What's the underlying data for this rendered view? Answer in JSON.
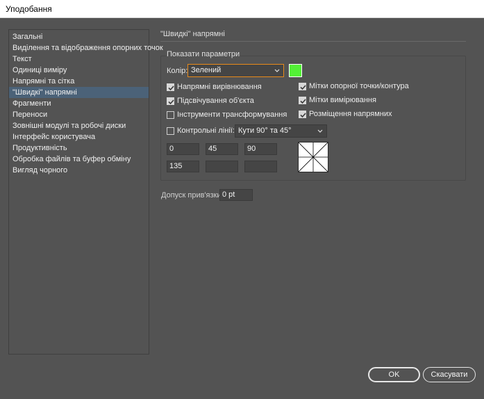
{
  "window": {
    "title": "Уподобання"
  },
  "sidebar": {
    "items": [
      {
        "label": "Загальні",
        "selected": false
      },
      {
        "label": "Виділення та відображення опорних точок",
        "selected": false
      },
      {
        "label": "Текст",
        "selected": false
      },
      {
        "label": "Одиниці виміру",
        "selected": false
      },
      {
        "label": "Напрямні та сітка",
        "selected": false
      },
      {
        "label": "\"Швидкі\" напрямні",
        "selected": true
      },
      {
        "label": "Фрагменти",
        "selected": false
      },
      {
        "label": "Переноси",
        "selected": false
      },
      {
        "label": "Зовнішні модулі та робочі диски",
        "selected": false
      },
      {
        "label": "Інтерфейс користувача",
        "selected": false
      },
      {
        "label": "Продуктивність",
        "selected": false
      },
      {
        "label": "Обробка файлів та буфер обміну",
        "selected": false
      },
      {
        "label": "Вигляд чорного",
        "selected": false
      }
    ]
  },
  "panel": {
    "section_title": "\"Швидкі\" напрямні",
    "group_title": "Показати параметри",
    "color_label": "Колір:",
    "color_value": "Зелений",
    "color_swatch": "#53f036",
    "checkboxes": {
      "align_guides": {
        "label": "Напрямні вирівнювання",
        "checked": true
      },
      "object_highlight": {
        "label": "Підсвічування об'єкта",
        "checked": true
      },
      "transform_tools": {
        "label": "Інструменти трансформування",
        "checked": false
      },
      "anchor_labels": {
        "label": "Мітки опорної точки/контура",
        "checked": true
      },
      "measurement_labels": {
        "label": "Мітки вимірювання",
        "checked": true
      },
      "guide_placement": {
        "label": "Розміщення напрямних",
        "checked": true
      },
      "construction_lines": {
        "label": "Контрольні лінії:",
        "checked": false
      }
    },
    "angles_select": "Кути 90° та 45°",
    "angle_fields": [
      "0",
      "45",
      "90",
      "135",
      "",
      ""
    ],
    "snap_label": "Допуск прив'язки:",
    "snap_value": "0 pt"
  },
  "buttons": {
    "ok": "OK",
    "cancel": "Скасувати"
  }
}
